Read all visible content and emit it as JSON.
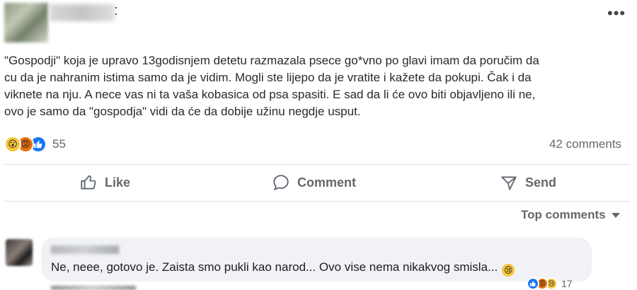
{
  "post": {
    "more_icon": "•••",
    "author_separator": ":",
    "text_lines": [
      "\"Gospodji\" koja je upravo 13godisnjem detetu razmazala psece go*vno po glavi imam da poručim da",
      "cu da je nahranim istima samo da je vidim. Mogli ste lijepo da je vratite i kažete da pokupi. Čak i da",
      "viknete na nju. A nece vas ni ta vaša kobasica od psa spasiti. E sad da li će ovo biti objavljeno ili ne,",
      "ovo je samo da \"gospodja\" vidi da će da dobije užinu negdje  usput."
    ],
    "reactions": {
      "icons": [
        "wow-icon",
        "angry-icon",
        "like-icon"
      ],
      "count": "55"
    },
    "comments_count": "42 comments"
  },
  "actions": {
    "like": "Like",
    "comment": "Comment",
    "send": "Send"
  },
  "top_comments": "Top comments",
  "comment": {
    "text": "Ne, neee, gotovo je. Zaista smo pukli kao narod... Ovo vise nema nikakvog smisla...",
    "reactions_count": "17"
  },
  "colors": {
    "like_blue": "#1877f2",
    "wow_yellow": "#f7c639",
    "angry_orange": "#e9710f",
    "muted_text": "#65676b"
  }
}
